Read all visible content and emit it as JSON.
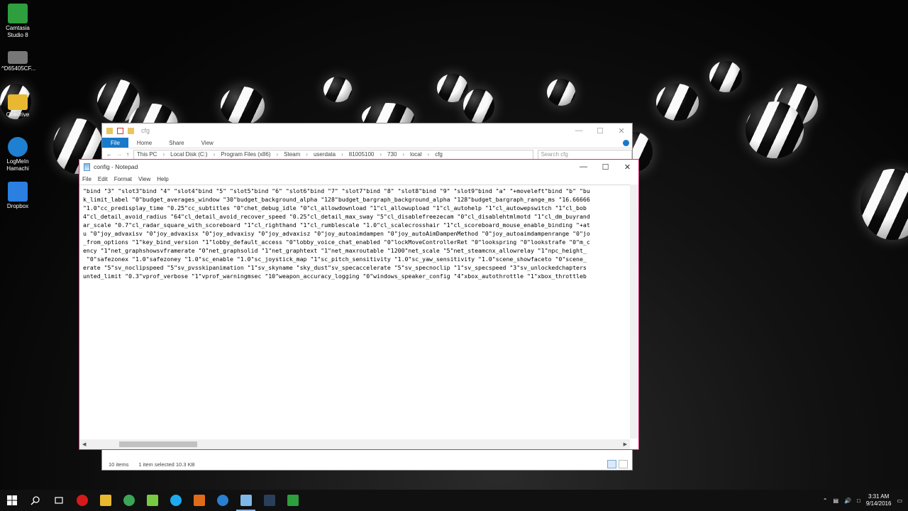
{
  "desktop_icons": [
    {
      "label": "Camtasia Studio 8",
      "color": "#2e9e3e"
    },
    {
      "label": "^D65405CF...",
      "color": "#777777"
    },
    {
      "label": "Onedrive",
      "color": "#e8b830"
    },
    {
      "label": "LogMeIn Hamachi",
      "color": "#1f7fd0"
    },
    {
      "label": "Dropbox",
      "color": "#2a7fe0"
    }
  ],
  "explorer": {
    "title": "cfg",
    "tabs": {
      "file": "File",
      "home": "Home",
      "share": "Share",
      "view": "View"
    },
    "path": [
      "This PC",
      "Local Disk (C:)",
      "Program Files (x86)",
      "Steam",
      "userdata",
      "81005100",
      "730",
      "local",
      "cfg"
    ],
    "search_placeholder": "Search cfg",
    "status_items": "10 items",
    "status_selected": "1 item selected  10.3 KB"
  },
  "notepad": {
    "title": "config - Notepad",
    "menu": {
      "file": "File",
      "edit": "Edit",
      "format": "Format",
      "view": "View",
      "help": "Help"
    },
    "lines": [
      "\"bind \"3\" \"slot3\"bind \"4\" \"slot4\"bind \"5\" \"slot5\"bind \"6\" \"slot6\"bind \"7\" \"slot7\"bind \"8\" \"slot8\"bind \"9\" \"slot9\"bind \"a\" \"+moveleft\"bind \"b\" \"bu",
      "k_limit_label \"0\"budget_averages_window \"30\"budget_background_alpha \"128\"budget_bargraph_background_alpha \"128\"budget_bargraph_range_ms \"16.66666",
      "\"1.0\"cc_predisplay_time \"0.25\"cc_subtitles \"0\"chet_debug_idle \"0\"cl_allowdownload \"1\"cl_allowupload \"1\"cl_autohelp \"1\"cl_autowepswitch \"1\"cl_bob",
      "4\"cl_detail_avoid_radius \"64\"cl_detail_avoid_recover_speed \"0.25\"cl_detail_max_sway \"5\"cl_disablefreezecam \"0\"cl_disablehtmlmotd \"1\"cl_dm_buyrand",
      "ar_scale \"0.7\"cl_radar_square_with_scoreboard \"1\"cl_righthand \"1\"cl_rumblescale \"1.0\"cl_scalecrosshair \"1\"cl_scoreboard_mouse_enable_binding \"+at",
      "u \"0\"joy_advaxisv \"0\"joy_advaxisx \"0\"joy_advaxisy \"0\"joy_advaxisz \"0\"joy_autoaimdampen \"0\"joy_autoAimDampenMethod \"0\"joy_autoaimdampenrange \"0\"jo",
      "_from_options \"1\"key_bind_version \"1\"lobby_default_access \"0\"lobby_voice_chat_enabled \"0\"lockMoveControllerRet \"0\"lookspring \"0\"lookstrafe \"0\"m_c",
      "ency \"1\"net_graphshowsvframerate \"0\"net_graphsolid \"1\"net_graphtext \"1\"net_maxroutable \"1200\"net_scale \"5\"net_steamcnx_allowrelay \"1\"npc_height_",
      " \"0\"safezonex \"1.0\"safezoney \"1.0\"sc_enable \"1.0\"sc_joystick_map \"1\"sc_pitch_sensitivity \"1.0\"sc_yaw_sensitivity \"1.0\"scene_showfaceto \"0\"scene_",
      "erate \"5\"sv_noclipspeed \"5\"sv_pvsskipanimation \"1\"sv_skyname \"sky_dust\"sv_specaccelerate \"5\"sv_specnoclip \"1\"sv_specspeed \"3\"sv_unlockedchapters",
      "unted_limit \"0.3\"vprof_verbose \"1\"vprof_warningmsec \"10\"weapon_accuracy_logging \"0\"windows_speaker_config \"4\"xbox_autothrottle \"1\"xbox_throttleb"
    ]
  },
  "taskbar": {
    "apps": [
      {
        "name": "opera-icon",
        "color": "#d61a1a"
      },
      {
        "name": "file-explorer-icon",
        "color": "#e8b830"
      },
      {
        "name": "chrome-icon",
        "color": "#3aa757"
      },
      {
        "name": "photos-icon",
        "color": "#7ac943"
      },
      {
        "name": "skype-icon",
        "color": "#1eaaf1"
      },
      {
        "name": "java-icon",
        "color": "#e06c1a"
      },
      {
        "name": "hamachi-icon",
        "color": "#2a7fd0"
      },
      {
        "name": "notepad-icon",
        "color": "#7fb8e8"
      },
      {
        "name": "steam-icon",
        "color": "#2a3f5a"
      },
      {
        "name": "camtasia-icon",
        "color": "#2e9e3e"
      }
    ],
    "time": "3:31 AM",
    "date": "9/14/2016"
  }
}
